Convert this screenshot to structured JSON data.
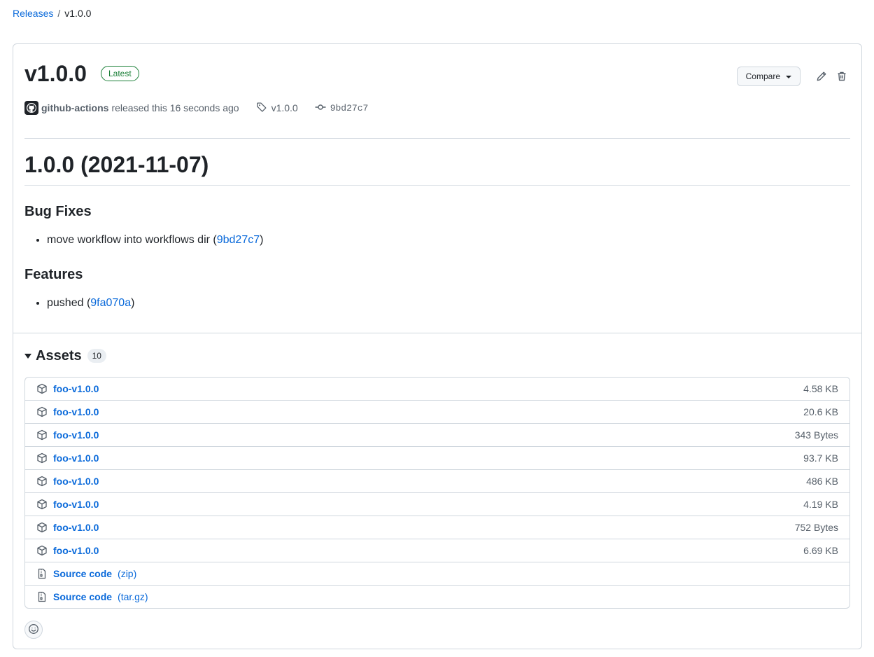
{
  "breadcrumb": {
    "parent": "Releases",
    "separator": "/",
    "current": "v1.0.0"
  },
  "release": {
    "title": "v1.0.0",
    "badge": "Latest",
    "compare_label": "Compare",
    "author": "github-actions",
    "released_text": "released this 16 seconds ago",
    "tag": "v1.0.0",
    "commit": "9bd27c7"
  },
  "notes": {
    "heading": "1.0.0 (2021-11-07)",
    "sections": [
      {
        "title": "Bug Fixes",
        "item_text": "move workflow into workflows dir (",
        "item_link": "9bd27c7",
        "item_close": ")"
      },
      {
        "title": "Features",
        "item_text": "pushed (",
        "item_link": "9fa070a",
        "item_close": ")"
      }
    ]
  },
  "assets": {
    "title": "Assets",
    "count": "10",
    "items": [
      {
        "name": "foo-v1.0.0",
        "size": "4.58 KB"
      },
      {
        "name": "foo-v1.0.0",
        "size": "20.6 KB"
      },
      {
        "name": "foo-v1.0.0",
        "size": "343 Bytes"
      },
      {
        "name": "foo-v1.0.0",
        "size": "93.7 KB"
      },
      {
        "name": "foo-v1.0.0",
        "size": "486 KB"
      },
      {
        "name": "foo-v1.0.0",
        "size": "4.19 KB"
      },
      {
        "name": "foo-v1.0.0",
        "size": "752 Bytes"
      },
      {
        "name": "foo-v1.0.0",
        "size": "6.69 KB"
      }
    ],
    "source": [
      {
        "name": "Source code",
        "ext": "(zip)"
      },
      {
        "name": "Source code",
        "ext": "(tar.gz)"
      }
    ]
  },
  "icons": {
    "package": "package-icon",
    "file_zip": "file-zip-icon",
    "tag": "tag-icon",
    "commit": "git-commit-icon",
    "edit": "pencil-icon",
    "delete": "trash-icon",
    "reaction": "smiley-icon"
  },
  "colors": {
    "link": "#0969da",
    "badge_green": "#1a7f37",
    "border": "#d0d7de",
    "muted": "#57606a"
  }
}
